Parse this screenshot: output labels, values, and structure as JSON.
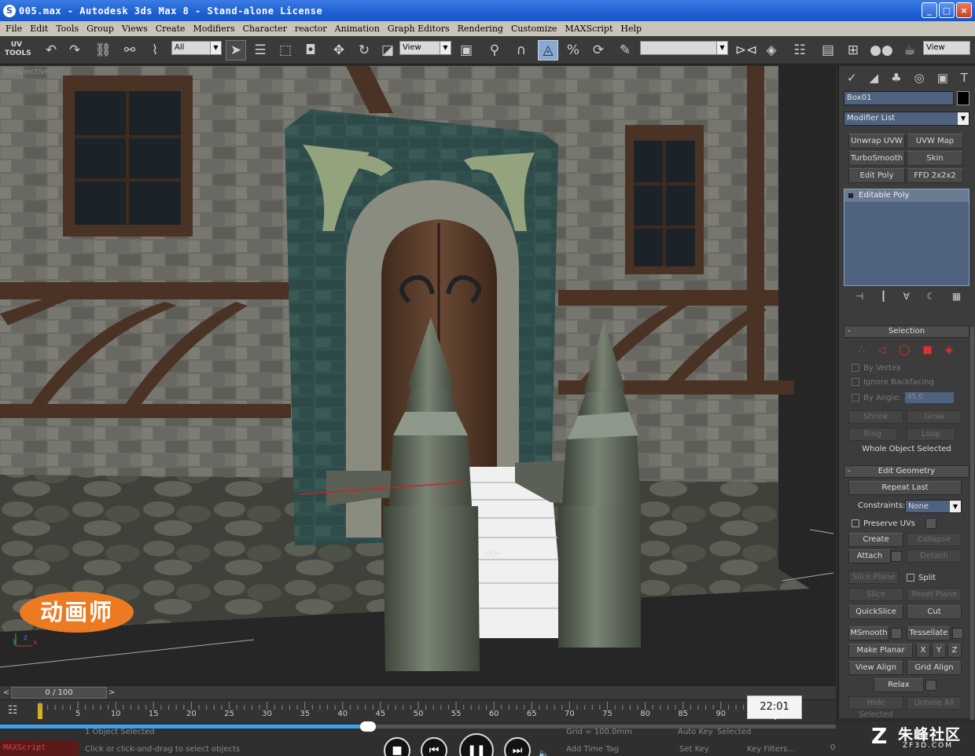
{
  "window": {
    "title": "005.max - Autodesk 3ds Max 8 - Stand-alone License",
    "buttons": {
      "minimize": "_",
      "maximize": "□",
      "close": "×"
    }
  },
  "menu": [
    "File",
    "Edit",
    "Tools",
    "Group",
    "Views",
    "Create",
    "Modifiers",
    "Character",
    "reactor",
    "Animation",
    "Graph Editors",
    "Rendering",
    "Customize",
    "MAXScript",
    "Help"
  ],
  "toolbar": {
    "uv_tools": "UV TOOLS",
    "selection_filter": "All",
    "ref_coord": "View",
    "named_selection": "",
    "view_right": "View"
  },
  "viewport": {
    "label": "Perspective"
  },
  "command_panel": {
    "object_name": "Box01",
    "modifier_list": "Modifier List",
    "modifier_buttons": [
      "Unwrap UVW",
      "UVW Map",
      "TurboSmooth",
      "Skin",
      "Edit Poly",
      "FFD 2x2x2"
    ],
    "stack_item": "Editable Poly",
    "selection": {
      "title": "Selection",
      "by_vertex": "By Vertex",
      "ignore_backfacing": "Ignore Backfacing",
      "by_angle": "By Angle:",
      "angle_value": "45.0",
      "shrink": "Shrink",
      "grow": "Grow",
      "ring": "Ring",
      "loop": "Loop",
      "status": "Whole Object Selected"
    },
    "edit_geometry": {
      "title": "Edit Geometry",
      "repeat_last": "Repeat Last",
      "constraints_label": "Constraints:",
      "constraints_value": "None",
      "preserve_uvs": "Preserve UVs",
      "create": "Create",
      "collapse": "Collapse",
      "attach": "Attach",
      "detach": "Detach",
      "slice_plane": "Slice Plane",
      "split": "Split",
      "slice": "Slice",
      "reset_plane": "Reset Plane",
      "quickslice": "QuickSlice",
      "cut": "Cut",
      "msmooth": "MSmooth",
      "tessellate": "Tessellate",
      "make_planar": "Make Planar",
      "x": "X",
      "y": "Y",
      "z": "Z",
      "view_align": "View Align",
      "grid_align": "Grid Align",
      "relax": "Relax",
      "hide_selected": "Hide Selected",
      "unhide_all": "Unhide All"
    }
  },
  "timeline": {
    "frame": "0 / 100",
    "ticks": [
      "5",
      "10",
      "15",
      "20",
      "25",
      "30",
      "35",
      "40",
      "45",
      "50",
      "55",
      "60",
      "65",
      "70",
      "75",
      "80",
      "85",
      "90"
    ]
  },
  "status": {
    "maxscript": "MAXScript",
    "selected": "1 Object Selected",
    "prompt": "Click or click-and-drag to select objects",
    "grid": "Grid = 100.0mm",
    "auto_key": "Auto Key",
    "selected_drop": "Selected",
    "set_key": "Set Key",
    "key_filters": "Key Filters...",
    "add_time_tag": "Add Time Tag",
    "frame_field": "0"
  },
  "video": {
    "timestamp": "22:01",
    "progress": 0.44
  },
  "overlay": {
    "logo_text": "动画师",
    "watermark_big": "朱峰社区",
    "watermark_small": "ZF3D.COM"
  },
  "colors": {
    "title_bar": "#1f5fd0",
    "viewport_bg": "#262626",
    "panel_bg": "#3c3c3c",
    "active_tool": "#8aa8d0",
    "logo": "#ec7a22",
    "progress": "#3aa0f0"
  }
}
